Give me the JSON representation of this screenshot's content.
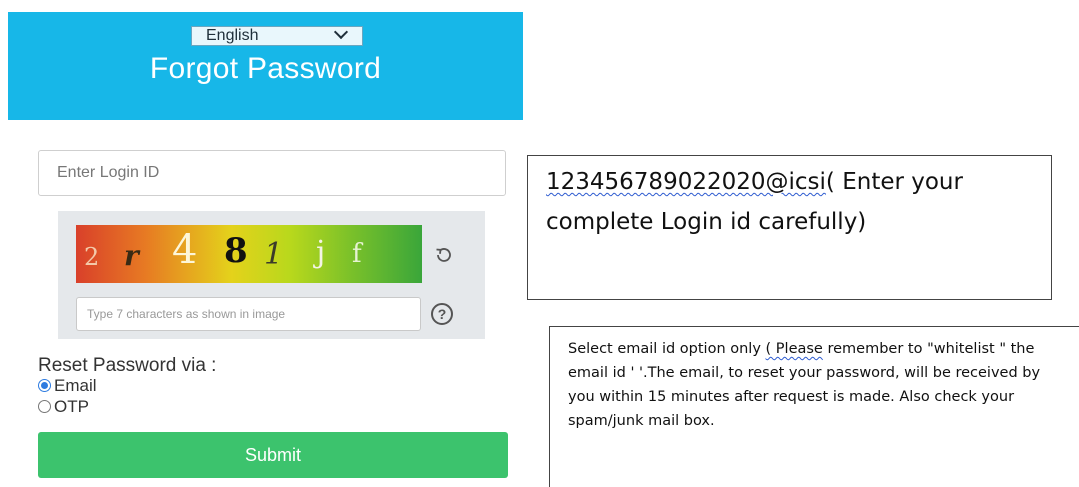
{
  "header": {
    "language": "English",
    "title": "Forgot Password"
  },
  "form": {
    "login_placeholder": "Enter Login ID",
    "captcha_text": [
      "2",
      "r",
      "4",
      "8",
      "1",
      "j",
      "f"
    ],
    "captcha_placeholder": "Type 7 characters as shown in image",
    "help_symbol": "?",
    "reset_label": "Reset Password via :",
    "options": [
      {
        "label": "Email",
        "checked": true
      },
      {
        "label": "OTP",
        "checked": false
      }
    ],
    "submit_label": "Submit"
  },
  "notes": {
    "login_hint_id": "123456789022020@icsi",
    "login_hint_rest": "( Enter your complete Login id carefully)",
    "email_note_pre": "Select email id option only ",
    "email_note_please": "( Please",
    "email_note_post": " remember to \"whitelist \" the email id ' '.The email, to reset your password, will be received by you within 15 minutes after request is made. Also check your spam/junk mail box."
  },
  "colors": {
    "header_bg": "#17b7e8",
    "submit_bg": "#3cc36d",
    "radio_accent": "#2d7be0"
  }
}
